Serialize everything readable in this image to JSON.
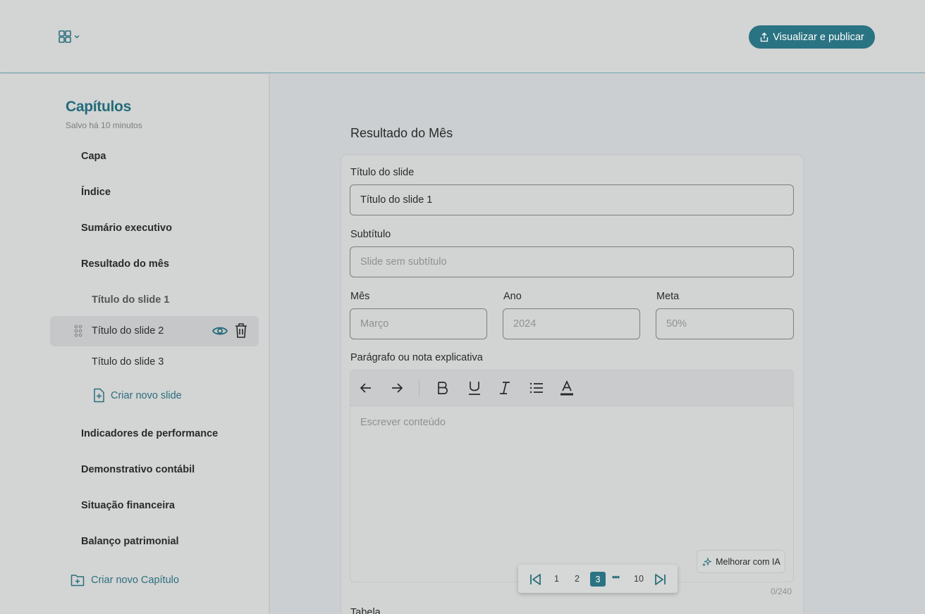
{
  "header": {
    "publish_label": "Visualizar e publicar"
  },
  "sidebar": {
    "title": "Capítulos",
    "saved_status": "Salvo há 10 minutos",
    "chapters": [
      {
        "label": "Capa"
      },
      {
        "label": "Índice"
      },
      {
        "label": "Sumário executivo"
      },
      {
        "label": "Resultado do mês"
      },
      {
        "label": "Indicadores de performance"
      },
      {
        "label": "Demonstrativo contábil"
      },
      {
        "label": "Situação financeira"
      },
      {
        "label": "Balanço patrimonial"
      }
    ],
    "slides": [
      {
        "label": "Título do slide 1"
      },
      {
        "label": "Título do slide 2"
      },
      {
        "label": "Título do slide 3"
      }
    ],
    "new_slide_label": "Criar novo slide",
    "new_chapter_label": "Criar novo Capítulo"
  },
  "main": {
    "section_title": "Resultado do Mês",
    "slide_title_label": "Título do slide",
    "slide_title_value": "Título do slide 1",
    "subtitle_label": "Subtítulo",
    "subtitle_placeholder": "Slide sem subtítulo",
    "month_label": "Mês",
    "month_placeholder": "Março",
    "year_label": "Ano",
    "year_placeholder": "2024",
    "goal_label": "Meta",
    "goal_placeholder": "50%",
    "paragraph_label": "Parágrafo ou nota explicativa",
    "editor_placeholder": "Escrever conteúdo",
    "ai_button_label": "Melhorar com IA",
    "char_counter": "0/240",
    "table_label": "Tabela"
  },
  "pagination": {
    "pages": [
      "1",
      "2",
      "3",
      "10"
    ],
    "current": "3",
    "ellipsis": "•••"
  },
  "colors": {
    "accent": "#2a7382",
    "background": "#d3d4d4"
  },
  "icons": [
    "grid-icon",
    "chevron-down-icon",
    "share-icon",
    "drag-handle-icon",
    "eye-icon",
    "trash-icon",
    "file-plus-icon",
    "folder-plus-icon",
    "undo-arrow-icon",
    "redo-arrow-icon",
    "bold-icon",
    "underline-icon",
    "italic-icon",
    "list-icon",
    "text-color-icon",
    "sparkle-icon",
    "first-page-icon",
    "last-page-icon"
  ]
}
